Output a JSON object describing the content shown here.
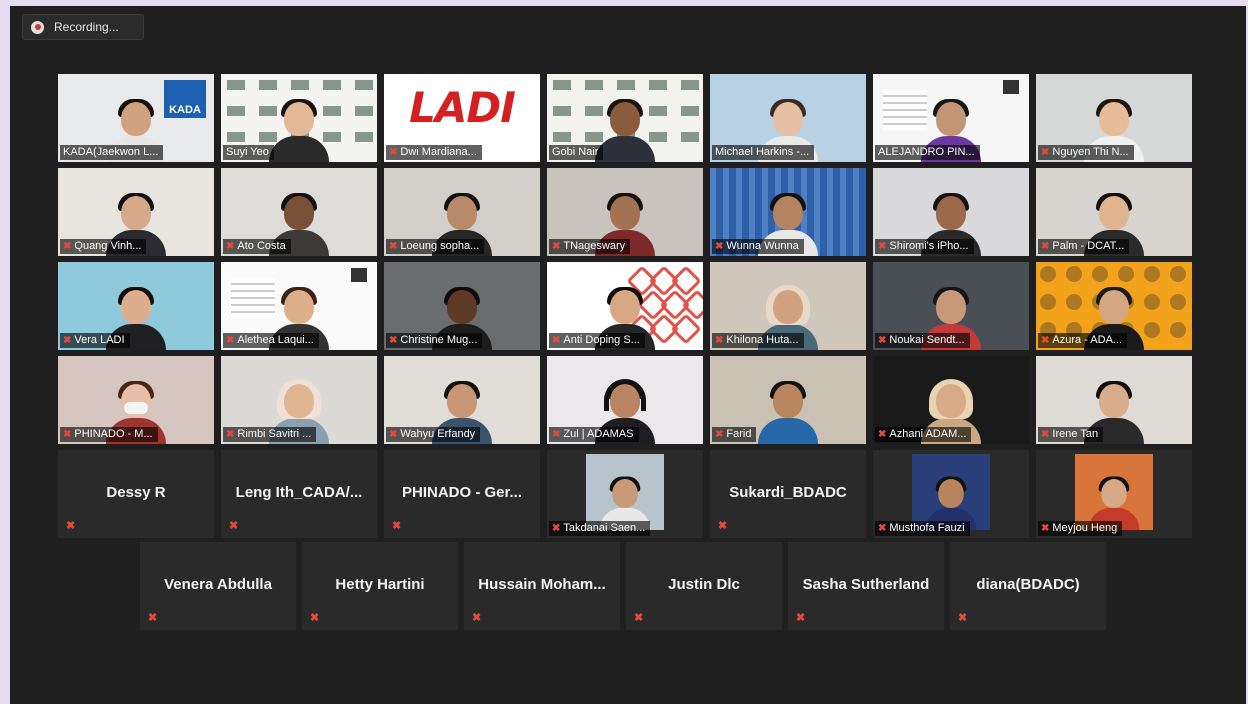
{
  "recording": {
    "label": "Recording..."
  },
  "tiles": [
    {
      "name": "KADA(Jaekwon L...",
      "bg": "#e9eaec",
      "shirt": "#e6e6e6",
      "hair": "#15100c",
      "skin": "#d0a27f",
      "extra": "kada",
      "muted": false
    },
    {
      "name": "Suyi Yeo",
      "bg": "#f4f4f2",
      "shirt": "#2a2a2a",
      "hair": "#1a1210",
      "skin": "#e2b896",
      "extra": "backdrop",
      "muted": false
    },
    {
      "name": "Dwi Mardiana...",
      "bg": "#ffffff",
      "shirt": "",
      "hair": "",
      "skin": "",
      "extra": "ladi",
      "muted": true
    },
    {
      "name": "Gobi Nair",
      "bg": "#f2f2ee",
      "shirt": "#2d2f3a",
      "hair": "#1a1410",
      "skin": "#8a5b3c",
      "extra": "backdrop",
      "muted": false,
      "active": true
    },
    {
      "name": "Michael Harkins -...",
      "bg": "#b9d1e4",
      "shirt": "#eaeaea",
      "hair": "#3a2b22",
      "skin": "#e6c0a2",
      "extra": "",
      "muted": false
    },
    {
      "name": "ALEJANDRO PIN...",
      "bg": "#f6f6f6",
      "shirt": "#6a3aa0",
      "hair": "#161616",
      "skin": "#c49574",
      "extra": "poster",
      "muted": false
    },
    {
      "name": "Nguyen Thi N...",
      "bg": "#d6d8d8",
      "shirt": "#f0f0f0",
      "hair": "#1b1411",
      "skin": "#e6bd98",
      "extra": "",
      "muted": true
    },
    {
      "name": "Quang Vinh...",
      "bg": "#e8e4df",
      "shirt": "#2a2a30",
      "hair": "#141010",
      "skin": "#d7a88a",
      "extra": "",
      "muted": true
    },
    {
      "name": "Ato Costa",
      "bg": "#dedcd8",
      "shirt": "#3c3a38",
      "hair": "#111",
      "skin": "#7a5038",
      "extra": "",
      "muted": true
    },
    {
      "name": "Loeung sopha...",
      "bg": "#d2cfcb",
      "shirt": "#262626",
      "hair": "#121010",
      "skin": "#b98a6a",
      "extra": "",
      "muted": true
    },
    {
      "name": "TNageswary",
      "bg": "#c9c3bd",
      "shirt": "#7e2a2a",
      "hair": "#151010",
      "skin": "#a27252",
      "extra": "",
      "muted": true
    },
    {
      "name": "Wunna Wunna",
      "bg": "#2f5fa6",
      "shirt": "#e8e8e8",
      "hair": "#111",
      "skin": "#b4835f",
      "extra": "blinds",
      "muted": true
    },
    {
      "name": "Shiromi's iPho...",
      "bg": "#d9d9dc",
      "shirt": "#2a2a2a",
      "hair": "#1a1410",
      "skin": "#9c6a4a",
      "extra": "",
      "muted": true
    },
    {
      "name": "Palm - DCAT...",
      "bg": "#d8d4d0",
      "shirt": "#2b2b2b",
      "hair": "#0f0c0a",
      "skin": "#e1b490",
      "extra": "",
      "muted": true
    },
    {
      "name": "Vera LADI",
      "bg": "#8fc9dc",
      "shirt": "#202024",
      "hair": "#120d0b",
      "skin": "#dcae8e",
      "extra": "",
      "muted": true
    },
    {
      "name": "Alethea Laqui...",
      "bg": "#fafafa",
      "shirt": "#333",
      "hair": "#3a2218",
      "skin": "#ddb08c",
      "extra": "poster",
      "muted": true
    },
    {
      "name": "Christine Mug...",
      "bg": "#6b6c6e",
      "shirt": "#1d1d1d",
      "hair": "#0e0b0a",
      "skin": "#5c3a26",
      "extra": "",
      "muted": true
    },
    {
      "name": "Anti Doping S...",
      "bg": "#ffffff",
      "shirt": "#262626",
      "hair": "#110d0b",
      "skin": "#d8a884",
      "extra": "hex",
      "muted": true
    },
    {
      "name": "Khilona Huta...",
      "bg": "#cfc7bc",
      "shirt": "#4a6a7a",
      "hair": "#e8d8c8",
      "skin": "#d2a17f",
      "extra": "hijab",
      "muted": true
    },
    {
      "name": "Noukai Sendt...",
      "bg": "#4a4e55",
      "shirt": "#c23a3a",
      "hair": "#161616",
      "skin": "#c99878",
      "extra": "",
      "muted": true
    },
    {
      "name": "Azura - ADA...",
      "bg": "#f3a21c",
      "shirt": "#1b1b1b",
      "hair": "#1b1b1b",
      "skin": "#d4a682",
      "extra": "pattern",
      "muted": true
    },
    {
      "name": "PHINADO - M...",
      "bg": "#d6c6c0",
      "shirt": "#a0342e",
      "hair": "#4a2618",
      "skin": "#e6bfa6",
      "extra": "mask",
      "muted": true
    },
    {
      "name": "Rimbi Savitri ...",
      "bg": "#dcdad6",
      "shirt": "#8aa0b0",
      "hair": "#f0e0d8",
      "skin": "#e0b592",
      "extra": "hijab",
      "muted": true
    },
    {
      "name": "Wahyu Erfandy",
      "bg": "#e0ddd8",
      "shirt": "#3a5470",
      "hair": "#141210",
      "skin": "#c89674",
      "extra": "",
      "muted": true
    },
    {
      "name": "Zul | ADAMAS",
      "bg": "#ebe8ec",
      "shirt": "#1d1d22",
      "hair": "#161616",
      "skin": "#b98462",
      "extra": "headphones",
      "muted": true
    },
    {
      "name": "Farid",
      "bg": "#c9c2b4",
      "shirt": "#2767a8",
      "hair": "#111",
      "skin": "#b98660",
      "extra": "",
      "muted": true
    },
    {
      "name": "Azhani ADAM...",
      "bg": "#1a1a1a",
      "shirt": "#caa882",
      "hair": "#e8d4b0",
      "skin": "#d8aa86",
      "extra": "hijab",
      "muted": true
    },
    {
      "name": "Irene Tan",
      "bg": "#dedad6",
      "shirt": "#2a2a2a",
      "hair": "#120e0c",
      "skin": "#d8ad8c",
      "extra": "",
      "muted": true
    },
    {
      "name": "Dessy R",
      "text_only": true
    },
    {
      "name": "Leng  Ith_CADA/...",
      "text_only": true
    },
    {
      "name": "PHINADO  -  Ger...",
      "text_only": true
    },
    {
      "name": "Takdanai Saen...",
      "bg": "#b7c4cc",
      "shirt": "#e8e8e8",
      "hair": "#111",
      "skin": "#c99a76",
      "extra": "small",
      "muted": true
    },
    {
      "name": "Sukardi_BDADC",
      "text_only": true
    },
    {
      "name": "Musthofa Fauzi",
      "bg": "#2a3f7a",
      "shirt": "#24306a",
      "hair": "#111",
      "skin": "#b8845e",
      "extra": "small",
      "muted": true
    },
    {
      "name": "Meyjou Heng",
      "bg": "#d9743a",
      "shirt": "#c63a2a",
      "hair": "#111",
      "skin": "#d6a884",
      "extra": "small",
      "muted": true
    }
  ],
  "bottom_tiles": [
    {
      "name": "Venera Abdulla"
    },
    {
      "name": "Hetty Hartini"
    },
    {
      "name": "Hussain  Moham..."
    },
    {
      "name": "Justin Dlc"
    },
    {
      "name": "Sasha Sutherland"
    },
    {
      "name": "diana(BDADC)"
    }
  ],
  "logos": {
    "ladi": "LADI",
    "kada": "KADA"
  },
  "icons": {
    "muted_mic": "mic-off-icon",
    "record": "record-icon"
  }
}
